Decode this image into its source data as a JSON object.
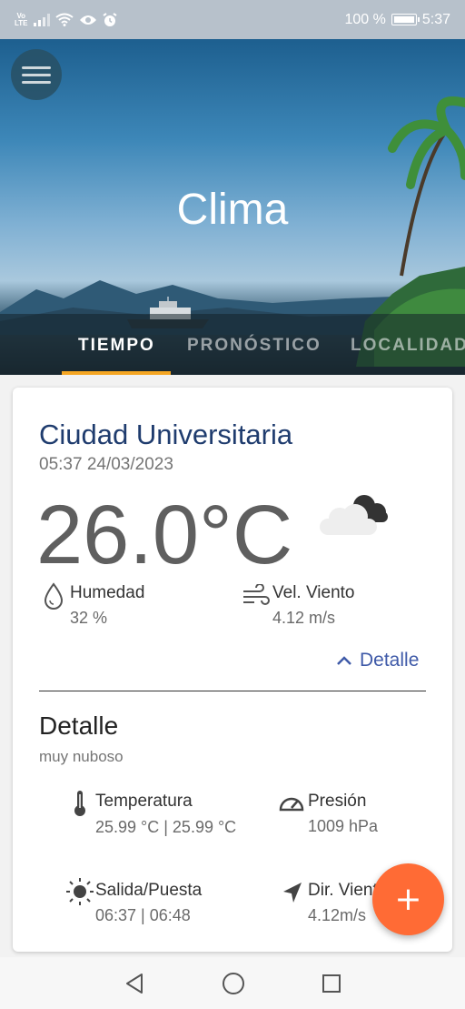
{
  "status_bar": {
    "volte_top": "Vo",
    "volte_bottom": "LTE",
    "battery": "100 %",
    "time": "5:37",
    "icons": [
      "signal-icon",
      "wifi-icon",
      "eye-icon",
      "alarm-icon",
      "battery-icon"
    ]
  },
  "header": {
    "title": "Clima",
    "menu_icon": "hamburger-menu-icon"
  },
  "tabs": [
    {
      "label": "TIEMPO",
      "active": true
    },
    {
      "label": "PRONÓSTICO",
      "active": false
    },
    {
      "label": "LOCALIDAD",
      "active": false
    }
  ],
  "colors": {
    "accent": "#f5a623",
    "fab": "#ff6b35",
    "city": "#1f3c6e",
    "link": "#3f5aa8"
  },
  "weather": {
    "city": "Ciudad Universitaria",
    "datetime": "05:37 24/03/2023",
    "temperature": "26.0°C",
    "condition_icon": "cloudy-icon",
    "humidity_label": "Humedad",
    "humidity_value": "32 %",
    "wind_label": "Vel. Viento",
    "wind_value": "4.12 m/s",
    "detail_toggle": "Detalle"
  },
  "detail": {
    "title": "Detalle",
    "description": "muy nuboso",
    "temperature_label": "Temperatura",
    "temperature_value": "25.99 °C | 25.99 °C",
    "pressure_label": "Presión",
    "pressure_value": "1009 hPa",
    "sun_label": "Salida/Puesta",
    "sun_value": "06:37 | 06:48",
    "wind_dir_label": "Dir. Viento",
    "wind_dir_value": "4.12m/s"
  },
  "fab": {
    "label": "+"
  },
  "nav": [
    "back-icon",
    "home-icon",
    "recents-icon"
  ]
}
